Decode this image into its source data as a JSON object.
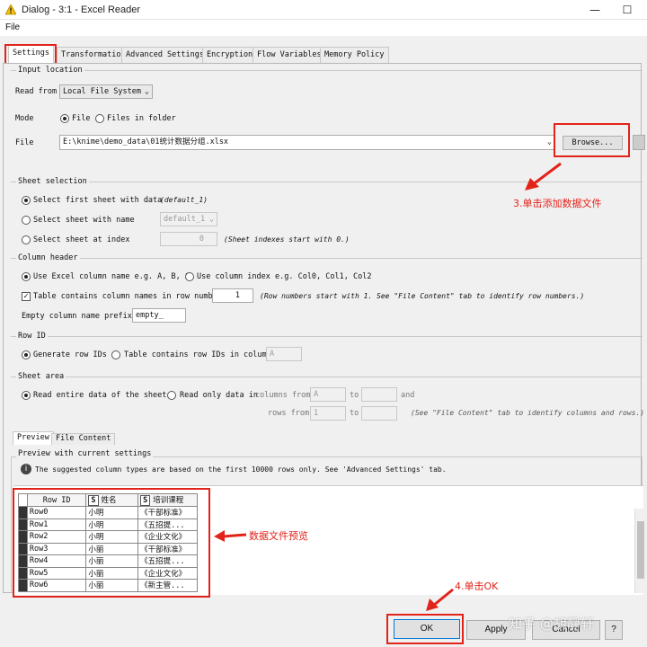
{
  "window": {
    "title": "Dialog - 3:1 - Excel Reader",
    "minimize": "—",
    "maximize": "☐"
  },
  "menu": {
    "file": "File"
  },
  "tabs": [
    "Settings",
    "Transformation",
    "Advanced Settings",
    "Encryption",
    "Flow Variables",
    "Memory Policy"
  ],
  "input_location": {
    "title": "Input location",
    "read_from_label": "Read from",
    "read_from_value": "Local File System",
    "mode_label": "Mode",
    "mode_file": "File",
    "mode_folder": "Files in folder",
    "file_label": "File",
    "file_value": "E:\\knime\\demo_data\\01统计数据分组.xlsx",
    "browse": "Browse..."
  },
  "sheet_selection": {
    "title": "Sheet selection",
    "opt_first": "Select first sheet with data",
    "opt_first_note": "(default_1)",
    "opt_name": "Select sheet with name",
    "opt_name_value": "default_1",
    "opt_index": "Select sheet at index",
    "opt_index_value": "0",
    "opt_index_note": "(Sheet indexes start with 0.)"
  },
  "column_header": {
    "title": "Column header",
    "opt_excel": "Use Excel column name e.g. A, B, C",
    "opt_index": "Use column index e.g. Col0, Col1, Col2",
    "contains_names": "Table contains column names in row number",
    "row_number": "1",
    "row_note": "(Row numbers start with 1. See \"File Content\" tab to identify row numbers.)",
    "empty_prefix_label": "Empty column name prefix:",
    "empty_prefix_value": "empty_"
  },
  "row_id": {
    "title": "Row ID",
    "opt_generate": "Generate row IDs",
    "opt_table": "Table contains row IDs in column",
    "column_value": "A"
  },
  "sheet_area": {
    "title": "Sheet area",
    "opt_entire": "Read entire data of the sheet",
    "opt_only": "Read only data in",
    "columns_from": "columns from",
    "col_from_value": "A",
    "to": "to",
    "and": "and",
    "rows_from": "rows from",
    "row_from_value": "1",
    "note": "(See \"File Content\" tab to identify columns and rows.)"
  },
  "preview_tabs": [
    "Preview",
    "File Content"
  ],
  "preview": {
    "title": "Preview with current settings",
    "info": "The suggested column types are based on the first 10000 rows only. See 'Advanced Settings' tab.",
    "columns": [
      "Row ID",
      "姓名",
      "培训课程"
    ],
    "type_badge": "S",
    "rows": [
      [
        "Row0",
        "小明",
        "《干部标准》"
      ],
      [
        "Row1",
        "小明",
        "《五招提..."
      ],
      [
        "Row2",
        "小明",
        "《企业文化》"
      ],
      [
        "Row3",
        "小丽",
        "《干部标准》"
      ],
      [
        "Row4",
        "小丽",
        "《五招提..."
      ],
      [
        "Row5",
        "小丽",
        "《企业文化》"
      ],
      [
        "Row6",
        "小丽",
        "《新主管..."
      ]
    ]
  },
  "buttons": {
    "ok": "OK",
    "apply": "Apply",
    "cancel": "Cancel",
    "help": "?"
  },
  "annotations": {
    "step3": "3.单击添加数据文件",
    "preview": "数据文件预览",
    "step4": "4.单击OK",
    "watermark": "知乎 @胡靜轩"
  },
  "colors": {
    "annotation": "#e2231a",
    "window_bg": "#f0f0f0"
  }
}
